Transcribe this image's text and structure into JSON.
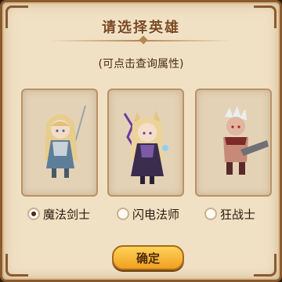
{
  "dialog": {
    "title": "请选择英雄",
    "subtitle": "(可点击查询属性)",
    "confirm_label": "确定"
  },
  "heroes": [
    {
      "label": "魔法剑士",
      "selected": true,
      "icon": "magic-swordsman-portrait"
    },
    {
      "label": "闪电法师",
      "selected": false,
      "icon": "lightning-mage-portrait"
    },
    {
      "label": "狂战士",
      "selected": false,
      "icon": "berserker-portrait"
    }
  ],
  "colors": {
    "panel": "#f1e1c4",
    "border": "#8a5a2e",
    "button": "#f0a020"
  }
}
